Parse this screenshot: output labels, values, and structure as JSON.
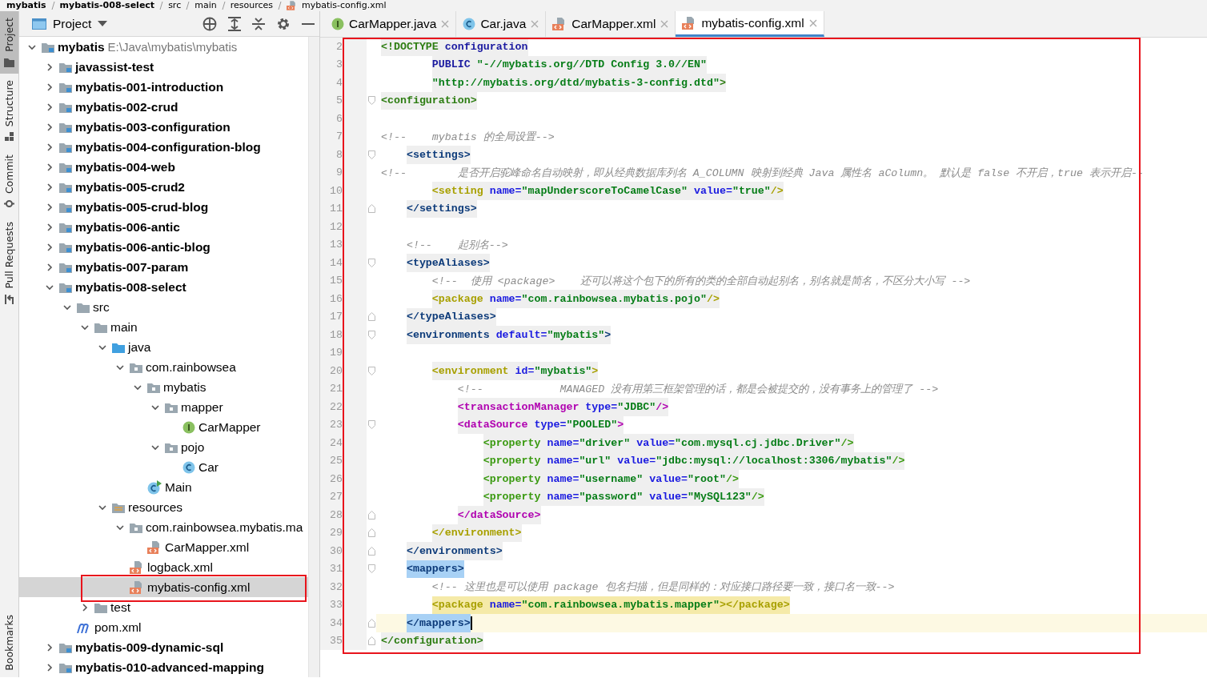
{
  "breadcrumb": [
    "mybatis",
    "mybatis-008-select",
    "src",
    "main",
    "resources",
    "mybatis-config.xml"
  ],
  "tool_stripe": {
    "top": [
      {
        "label": "Project",
        "kind": "project",
        "selected": true
      },
      {
        "label": "Structure",
        "kind": "structure",
        "selected": false
      },
      {
        "label": "Commit",
        "kind": "commit",
        "selected": false
      },
      {
        "label": "Pull Requests",
        "kind": "pull-requests",
        "selected": false
      }
    ],
    "bottom": [
      {
        "label": "Bookmarks",
        "selected": false
      }
    ]
  },
  "project_panel": {
    "title": "Project",
    "tree": [
      {
        "label": "mybatis",
        "path": "E:\\Java\\mybatis\\mybatis",
        "kind": "module",
        "expanded": true,
        "selected": false,
        "children": [
          {
            "label": "javassist-test",
            "kind": "module",
            "expanded": false,
            "selected": false
          },
          {
            "label": "mybatis-001-introduction",
            "kind": "module",
            "expanded": false,
            "selected": false
          },
          {
            "label": "mybatis-002-crud",
            "kind": "module",
            "expanded": false,
            "selected": false
          },
          {
            "label": "mybatis-003-configuration",
            "kind": "module",
            "expanded": false,
            "selected": false
          },
          {
            "label": "mybatis-004-configuration-blog",
            "kind": "module",
            "expanded": false,
            "selected": false
          },
          {
            "label": "mybatis-004-web",
            "kind": "module",
            "expanded": false,
            "selected": false
          },
          {
            "label": "mybatis-005-crud2",
            "kind": "module",
            "expanded": false,
            "selected": false
          },
          {
            "label": "mybatis-005-crud-blog",
            "kind": "module",
            "expanded": false,
            "selected": false
          },
          {
            "label": "mybatis-006-antic",
            "kind": "module",
            "expanded": false,
            "selected": false
          },
          {
            "label": "mybatis-006-antic-blog",
            "kind": "module",
            "expanded": false,
            "selected": false
          },
          {
            "label": "mybatis-007-param",
            "kind": "module",
            "expanded": false,
            "selected": false
          },
          {
            "label": "mybatis-008-select",
            "kind": "module",
            "expanded": true,
            "selected": false,
            "children": [
              {
                "label": "src",
                "kind": "folder",
                "expanded": true,
                "selected": false,
                "children": [
                  {
                    "label": "main",
                    "kind": "folder",
                    "expanded": true,
                    "selected": false,
                    "children": [
                      {
                        "label": "java",
                        "kind": "source-folder",
                        "expanded": true,
                        "selected": false,
                        "children": [
                          {
                            "label": "com.rainbowsea",
                            "kind": "package",
                            "expanded": true,
                            "selected": false,
                            "children": [
                              {
                                "label": "mybatis",
                                "kind": "package",
                                "expanded": true,
                                "selected": false,
                                "children": [
                                  {
                                    "label": "mapper",
                                    "kind": "package",
                                    "expanded": true,
                                    "selected": false,
                                    "children": [
                                      {
                                        "label": "CarMapper",
                                        "kind": "interface",
                                        "selected": false
                                      }
                                    ]
                                  },
                                  {
                                    "label": "pojo",
                                    "kind": "package",
                                    "expanded": true,
                                    "selected": false,
                                    "children": [
                                      {
                                        "label": "Car",
                                        "kind": "class",
                                        "selected": false
                                      }
                                    ]
                                  }
                                ]
                              },
                              {
                                "label": "Main",
                                "kind": "main-class",
                                "selected": false
                              }
                            ]
                          }
                        ]
                      },
                      {
                        "label": "resources",
                        "kind": "resources-folder",
                        "expanded": true,
                        "selected": false,
                        "children": [
                          {
                            "label": "com.rainbowsea.mybatis.ma",
                            "kind": "package",
                            "expanded": true,
                            "selected": false,
                            "children": [
                              {
                                "label": "CarMapper.xml",
                                "kind": "xml",
                                "selected": false
                              }
                            ]
                          },
                          {
                            "label": "logback.xml",
                            "kind": "xml",
                            "selected": false
                          },
                          {
                            "label": "mybatis-config.xml",
                            "kind": "xml",
                            "selected": true
                          }
                        ]
                      }
                    ]
                  },
                  {
                    "label": "test",
                    "kind": "folder",
                    "expanded": false,
                    "selected": false
                  }
                ]
              },
              {
                "label": "pom.xml",
                "kind": "maven",
                "selected": false
              }
            ]
          },
          {
            "label": "mybatis-009-dynamic-sql",
            "kind": "module",
            "expanded": false,
            "selected": false
          },
          {
            "label": "mybatis-010-advanced-mapping",
            "kind": "module",
            "expanded": false,
            "selected": false
          }
        ]
      }
    ]
  },
  "tabs": [
    {
      "label": "CarMapper.java",
      "kind": "interface",
      "selected": false
    },
    {
      "label": "Car.java",
      "kind": "class",
      "selected": false
    },
    {
      "label": "CarMapper.xml",
      "kind": "xml",
      "selected": false
    },
    {
      "label": "mybatis-config.xml",
      "kind": "xml",
      "selected": true
    }
  ],
  "editor": {
    "lines": [
      {
        "n": "2",
        "kind": "markup",
        "color": "#2d7d12",
        "fold_start": false,
        "fold_end": false,
        "brace_match": false,
        "pair_match": false,
        "current": false,
        "tokens": [
          {
            "kind": "tag",
            "text": "<!DOCTYPE"
          },
          {
            "kind": "keyword",
            "text": " configuration"
          }
        ]
      },
      {
        "n": "3",
        "kind": "markup",
        "fold_start": false,
        "fold_end": false,
        "brace_match": false,
        "pair_match": false,
        "current": false,
        "tokens": [
          {
            "kind": "keyword",
            "text": "        PUBLIC"
          },
          {
            "kind": "value",
            "text": " \"-//mybatis.org//DTD Config 3.0//EN\""
          }
        ]
      },
      {
        "n": "4",
        "kind": "markup",
        "color": "#2d7d12",
        "fold_start": false,
        "fold_end": false,
        "brace_match": false,
        "pair_match": false,
        "current": false,
        "tokens": [
          {
            "kind": "value",
            "text": "        \"http://mybatis.org/dtd/mybatis-3-config.dtd\""
          },
          {
            "kind": "tag",
            "text": ">"
          }
        ]
      },
      {
        "n": "5",
        "kind": "markup",
        "color": "#2d7d12",
        "fold_start": true,
        "fold_end": false,
        "brace_match": false,
        "pair_match": false,
        "current": false,
        "tokens": [
          {
            "kind": "tag",
            "text": "<configuration>"
          }
        ]
      },
      {
        "n": "6",
        "fold_start": false,
        "fold_end": false,
        "current": false
      },
      {
        "n": "7",
        "kind": "comment",
        "fold_start": false,
        "fold_end": false,
        "current": false,
        "tokens": [
          {
            "kind": "comment",
            "text": "<!--    mybatis 的全局设置-->"
          }
        ]
      },
      {
        "n": "8",
        "kind": "markup",
        "color": "#0d3b7a",
        "fold_start": true,
        "fold_end": false,
        "brace_match": false,
        "pair_match": false,
        "current": false,
        "tokens": [
          {
            "kind": "tag",
            "text": "    <settings>"
          }
        ]
      },
      {
        "n": "9",
        "kind": "comment",
        "fold_start": false,
        "fold_end": false,
        "current": false,
        "tokens": [
          {
            "kind": "comment",
            "text": "<!--        是否开启驼峰命名自动映射，即从经典数据库列名 A_COLUMN 映射到经典 Java 属性名 aColumn。 默认是 false 不开启，true 表示开启--"
          }
        ]
      },
      {
        "n": "10",
        "kind": "markup",
        "color": "#a8a000",
        "fold_start": false,
        "fold_end": false,
        "brace_match": false,
        "pair_match": false,
        "current": false,
        "tokens": [
          {
            "kind": "tag",
            "text": "        <setting"
          },
          {
            "kind": "attr",
            "text": " name="
          },
          {
            "kind": "value",
            "text": "\"mapUnderscoreToCamelCase\""
          },
          {
            "kind": "attr",
            "text": " value="
          },
          {
            "kind": "value",
            "text": "\"true\""
          },
          {
            "kind": "tag",
            "text": "/>"
          }
        ]
      },
      {
        "n": "11",
        "kind": "markup",
        "color": "#0d3b7a",
        "fold_start": false,
        "fold_end": true,
        "brace_match": false,
        "pair_match": false,
        "current": false,
        "tokens": [
          {
            "kind": "tag",
            "text": "    </settings>"
          }
        ]
      },
      {
        "n": "12",
        "fold_start": false,
        "fold_end": false,
        "current": false
      },
      {
        "n": "13",
        "kind": "comment",
        "fold_start": false,
        "fold_end": false,
        "current": false,
        "tokens": [
          {
            "kind": "comment",
            "text": "    <!--    起别名-->"
          }
        ]
      },
      {
        "n": "14",
        "kind": "markup",
        "color": "#0d3b7a",
        "fold_start": true,
        "fold_end": false,
        "brace_match": false,
        "pair_match": false,
        "current": false,
        "tokens": [
          {
            "kind": "tag",
            "text": "    <typeAliases>"
          }
        ]
      },
      {
        "n": "15",
        "kind": "comment",
        "fold_start": false,
        "fold_end": false,
        "current": false,
        "tokens": [
          {
            "kind": "comment",
            "text": "        <!--  使用 <package>    还可以将这个包下的所有的类的全部自动起别名，别名就是简名，不区分大小写 -->"
          }
        ]
      },
      {
        "n": "16",
        "kind": "markup",
        "color": "#a8a000",
        "fold_start": false,
        "fold_end": false,
        "brace_match": false,
        "pair_match": false,
        "current": false,
        "tokens": [
          {
            "kind": "tag",
            "text": "        <package"
          },
          {
            "kind": "attr",
            "text": " name="
          },
          {
            "kind": "value",
            "text": "\"com.rainbowsea.mybatis.pojo\""
          },
          {
            "kind": "tag",
            "text": "/>"
          }
        ]
      },
      {
        "n": "17",
        "kind": "markup",
        "color": "#0d3b7a",
        "fold_start": false,
        "fold_end": true,
        "brace_match": false,
        "pair_match": false,
        "current": false,
        "tokens": [
          {
            "kind": "tag",
            "text": "    </typeAliases>"
          }
        ]
      },
      {
        "n": "18",
        "kind": "markup",
        "color": "#0d3b7a",
        "fold_start": true,
        "fold_end": false,
        "brace_match": false,
        "pair_match": false,
        "current": false,
        "tokens": [
          {
            "kind": "tag",
            "text": "    <environments"
          },
          {
            "kind": "attr",
            "text": " default="
          },
          {
            "kind": "value",
            "text": "\"mybatis\""
          },
          {
            "kind": "tag",
            "text": ">"
          }
        ]
      },
      {
        "n": "19",
        "fold_start": false,
        "fold_end": false,
        "current": false
      },
      {
        "n": "20",
        "kind": "markup",
        "color": "#a8a000",
        "fold_start": true,
        "fold_end": false,
        "brace_match": false,
        "pair_match": false,
        "current": false,
        "tokens": [
          {
            "kind": "tag",
            "text": "        <environment"
          },
          {
            "kind": "attr",
            "text": " id="
          },
          {
            "kind": "value",
            "text": "\"mybatis\""
          },
          {
            "kind": "tag",
            "text": ">"
          }
        ]
      },
      {
        "n": "21",
        "kind": "comment",
        "fold_start": false,
        "fold_end": false,
        "current": false,
        "tokens": [
          {
            "kind": "comment",
            "text": "            <!--            MANAGED 没有用第三框架管理的话，都是会被提交的，没有事务上的管理了 -->"
          }
        ]
      },
      {
        "n": "22",
        "kind": "markup",
        "color": "#b000b0",
        "fold_start": false,
        "fold_end": false,
        "brace_match": false,
        "pair_match": false,
        "current": false,
        "tokens": [
          {
            "kind": "tag",
            "text": "            <transactionManager"
          },
          {
            "kind": "attr",
            "text": " type="
          },
          {
            "kind": "value",
            "text": "\"JDBC\""
          },
          {
            "kind": "tag",
            "text": "/>"
          }
        ]
      },
      {
        "n": "23",
        "kind": "markup",
        "color": "#b000b0",
        "fold_start": true,
        "fold_end": false,
        "brace_match": false,
        "pair_match": false,
        "current": false,
        "tokens": [
          {
            "kind": "tag",
            "text": "            <dataSource"
          },
          {
            "kind": "attr",
            "text": " type="
          },
          {
            "kind": "value",
            "text": "\"POOLED\""
          },
          {
            "kind": "tag",
            "text": ">"
          }
        ]
      },
      {
        "n": "24",
        "kind": "markup",
        "color": "#3a9a10",
        "fold_start": false,
        "fold_end": false,
        "brace_match": false,
        "pair_match": false,
        "current": false,
        "tokens": [
          {
            "kind": "tag",
            "text": "                <property"
          },
          {
            "kind": "attr",
            "text": " name="
          },
          {
            "kind": "value",
            "text": "\"driver\""
          },
          {
            "kind": "attr",
            "text": " value="
          },
          {
            "kind": "value",
            "text": "\"com.mysql.cj.jdbc.Driver\""
          },
          {
            "kind": "tag",
            "text": "/>"
          }
        ]
      },
      {
        "n": "25",
        "kind": "markup",
        "color": "#3a9a10",
        "fold_start": false,
        "fold_end": false,
        "brace_match": false,
        "pair_match": false,
        "current": false,
        "tokens": [
          {
            "kind": "tag",
            "text": "                <property"
          },
          {
            "kind": "attr",
            "text": " name="
          },
          {
            "kind": "value",
            "text": "\"url\""
          },
          {
            "kind": "attr",
            "text": " value="
          },
          {
            "kind": "value",
            "text": "\"jdbc:mysql://localhost:3306/mybatis\""
          },
          {
            "kind": "tag",
            "text": "/>"
          }
        ]
      },
      {
        "n": "26",
        "kind": "markup",
        "color": "#3a9a10",
        "fold_start": false,
        "fold_end": false,
        "brace_match": false,
        "pair_match": false,
        "current": false,
        "tokens": [
          {
            "kind": "tag",
            "text": "                <property"
          },
          {
            "kind": "attr",
            "text": " name="
          },
          {
            "kind": "value",
            "text": "\"username\""
          },
          {
            "kind": "attr",
            "text": " value="
          },
          {
            "kind": "value",
            "text": "\"root\""
          },
          {
            "kind": "tag",
            "text": "/>"
          }
        ]
      },
      {
        "n": "27",
        "kind": "markup",
        "color": "#3a9a10",
        "fold_start": false,
        "fold_end": false,
        "brace_match": false,
        "pair_match": false,
        "current": false,
        "tokens": [
          {
            "kind": "tag",
            "text": "                <property"
          },
          {
            "kind": "attr",
            "text": " name="
          },
          {
            "kind": "value",
            "text": "\"password\""
          },
          {
            "kind": "attr",
            "text": " value="
          },
          {
            "kind": "value",
            "text": "\"MySQL123\""
          },
          {
            "kind": "tag",
            "text": "/>"
          }
        ]
      },
      {
        "n": "28",
        "kind": "markup",
        "color": "#b000b0",
        "fold_start": false,
        "fold_end": true,
        "brace_match": false,
        "pair_match": false,
        "current": false,
        "tokens": [
          {
            "kind": "tag",
            "text": "            </dataSource>"
          }
        ]
      },
      {
        "n": "29",
        "kind": "markup",
        "color": "#a8a000",
        "fold_start": false,
        "fold_end": true,
        "brace_match": false,
        "pair_match": false,
        "current": false,
        "tokens": [
          {
            "kind": "tag",
            "text": "        </environment>"
          }
        ]
      },
      {
        "n": "30",
        "kind": "markup",
        "color": "#0d3b7a",
        "fold_start": false,
        "fold_end": true,
        "brace_match": false,
        "pair_match": false,
        "current": false,
        "tokens": [
          {
            "kind": "tag",
            "text": "    </environments>"
          }
        ]
      },
      {
        "n": "31",
        "kind": "markup",
        "color": "#0d3b7a",
        "fold_start": true,
        "fold_end": false,
        "brace_match": true,
        "pair_match": false,
        "current": false,
        "tokens": [
          {
            "kind": "tag",
            "text": "    <mappers>"
          }
        ]
      },
      {
        "n": "32",
        "kind": "comment",
        "fold_start": false,
        "fold_end": false,
        "current": false,
        "tokens": [
          {
            "kind": "comment",
            "text": "        <!-- 这里也是可以使用 package 包名扫描，但是同样的：对应接口路径要一致，接口名一致-->"
          }
        ]
      },
      {
        "n": "33",
        "kind": "markup",
        "color": "#a8a000",
        "fold_start": false,
        "fold_end": false,
        "brace_match": false,
        "pair_match": true,
        "current": false,
        "tokens": [
          {
            "kind": "tag",
            "text": "        <package"
          },
          {
            "kind": "attr",
            "text": " name="
          },
          {
            "kind": "value",
            "text": "\"com.rainbowsea.mybatis.mapper\""
          },
          {
            "kind": "tag",
            "text": "></package>"
          }
        ]
      },
      {
        "n": "34",
        "kind": "markup",
        "color": "#0d3b7a",
        "fold_start": false,
        "fold_end": true,
        "brace_match": true,
        "pair_match": false,
        "current": true,
        "tokens": [
          {
            "kind": "tag",
            "text": "    </mappers>"
          }
        ]
      },
      {
        "n": "35",
        "kind": "markup",
        "color": "#2d7d12",
        "fold_start": false,
        "fold_end": true,
        "brace_match": false,
        "pair_match": false,
        "current": false,
        "tokens": [
          {
            "kind": "tag",
            "text": "</configuration>"
          }
        ]
      }
    ]
  }
}
